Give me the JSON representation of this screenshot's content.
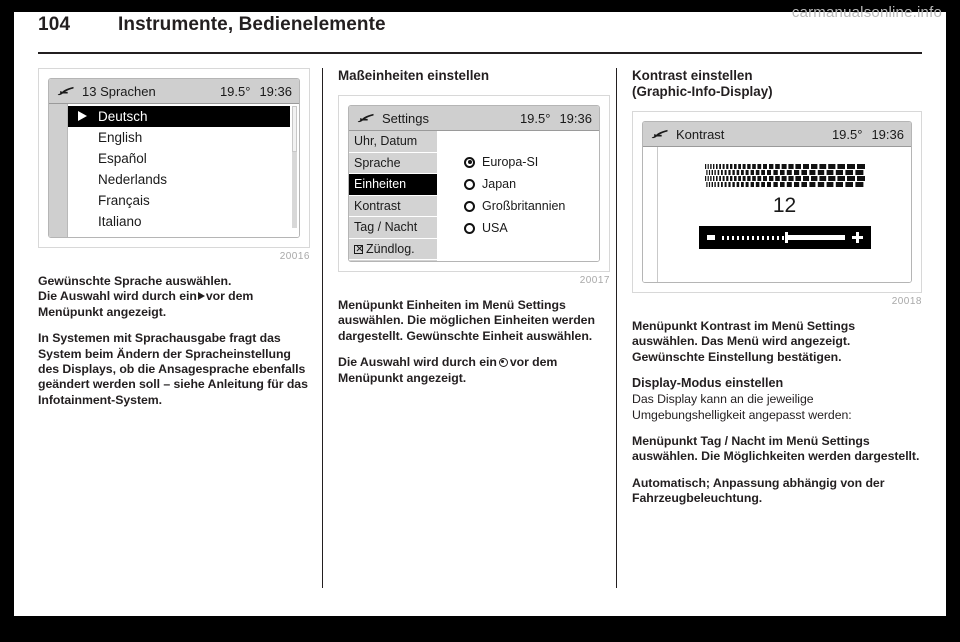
{
  "header": {
    "page_number": "104",
    "title": "Instrumente, Bedienelemente"
  },
  "footer": {
    "site": "carmanualsonline.info"
  },
  "columns": {
    "left": {
      "figure": {
        "caption": "20016",
        "screen": {
          "icon": "car-display-icon",
          "title": "13 Sprachen",
          "temperature": "19.5°",
          "time": "19:36",
          "items": [
            {
              "label": "Deutsch",
              "selected": true
            },
            {
              "label": "English",
              "selected": false
            },
            {
              "label": "Español",
              "selected": false
            },
            {
              "label": "Nederlands",
              "selected": false
            },
            {
              "label": "Français",
              "selected": false
            },
            {
              "label": "Italiano",
              "selected": false
            }
          ]
        }
      },
      "paragraphs": {
        "p1_a": "Gewünschte Sprache auswählen.",
        "p1_b": "Die Auswahl wird durch ein",
        "p1_c": "vor dem Menüpunkt angezeigt.",
        "p2": "In Systemen mit Sprachausgabe fragt das System beim Ändern der Spracheinstellung des Displays, ob die Ansagesprache ebenfalls geändert werden soll – siehe Anleitung für das Infotainment-System."
      }
    },
    "middle": {
      "heading": "Maßeinheiten einstellen",
      "figure": {
        "caption": "20017",
        "screen": {
          "icon": "car-display-icon",
          "title": "Settings",
          "temperature": "19.5°",
          "time": "19:36",
          "menu": [
            {
              "label": "Uhr, Datum",
              "selected": false,
              "checkbox": false
            },
            {
              "label": "Sprache",
              "selected": false,
              "checkbox": false
            },
            {
              "label": "Einheiten",
              "selected": true,
              "checkbox": false
            },
            {
              "label": "Kontrast",
              "selected": false,
              "checkbox": false
            },
            {
              "label": "Tag / Nacht",
              "selected": false,
              "checkbox": false
            },
            {
              "label": "Zündlog.",
              "selected": false,
              "checkbox": true
            }
          ],
          "options": [
            {
              "label": "Europa-SI",
              "selected": true
            },
            {
              "label": "Japan",
              "selected": false
            },
            {
              "label": "Großbritannien",
              "selected": false
            },
            {
              "label": "USA",
              "selected": false
            }
          ]
        }
      },
      "paragraphs": {
        "p1": "Menüpunkt Einheiten im Menü Settings auswählen. Die möglichen Einheiten werden dargestellt. Gewünschte Einheit auswählen.",
        "p2_a": "Die Auswahl wird durch ein",
        "p2_b": "vor dem Menüpunkt angezeigt."
      }
    },
    "right": {
      "heading_line1": "Kontrast einstellen",
      "heading_line2": "(Graphic-Info-Display)",
      "figure": {
        "caption": "20018",
        "screen": {
          "icon": "car-display-icon",
          "title": "Kontrast",
          "temperature": "19.5°",
          "time": "19:36",
          "value": "12",
          "slider": {
            "minus_label": "minus-icon",
            "plus_label": "plus-icon",
            "position_percent": 52
          }
        }
      },
      "paragraphs": {
        "p1": "Menüpunkt Kontrast im Menü Settings auswählen. Das Menü wird angezeigt. Gewünschte Einstellung bestätigen.",
        "sub_heading": "Display-Modus einstellen",
        "p2": "Das Display kann an die jeweilige Umgebungshelligkeit angepasst werden:",
        "p3": "Menüpunkt Tag / Nacht im Menü Settings auswählen. Die Möglichkeiten werden dargestellt.",
        "p4": "Automatisch; Anpassung abhängig von der Fahrzeugbeleuchtung."
      }
    }
  },
  "colors": {
    "page_bg": "#ffffff",
    "text": "#231f20",
    "frame": "#000000",
    "screen_bar": "#cfcfcf",
    "screen_menu": "#d3d3d3",
    "highlight": "#000000",
    "caption": "#a8a8a8"
  }
}
